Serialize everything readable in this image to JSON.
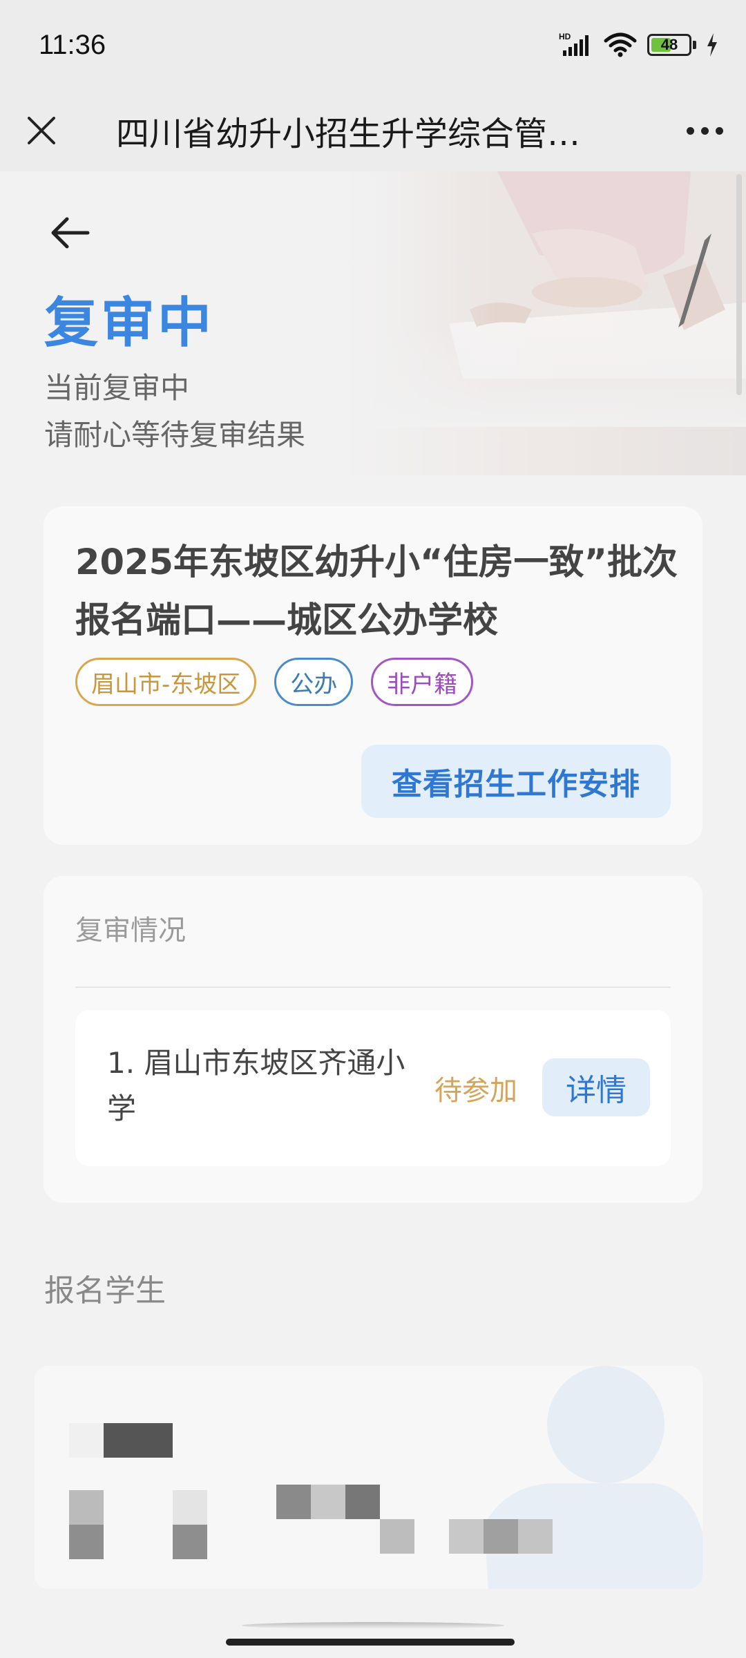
{
  "status_bar": {
    "time": "11:36",
    "network": "HD",
    "battery": "48"
  },
  "title_bar": {
    "title": "四川省幼升小招生升学综合管…"
  },
  "header": {
    "status_title": "复审中",
    "status_line1": "当前复审中",
    "status_line2": "请耐心等待复审结果"
  },
  "batch": {
    "title": "2025年东坡区幼升小“住房一致”批次报名端口——城区公办学校",
    "tags": [
      "眉山市-东坡区",
      "公办",
      "非户籍"
    ],
    "schedule_button": "查看招生工作安排"
  },
  "review": {
    "heading": "复审情况",
    "items": [
      {
        "name": "1. 眉山市东坡区齐通小学",
        "status": "待参加",
        "detail_label": "详情"
      }
    ]
  },
  "students": {
    "heading": "报名学生"
  },
  "colors": {
    "accent": "#3a86e0",
    "status_pending": "#d3a45a",
    "tag_region": "#c9963c",
    "tag_public": "#3a7ab8",
    "tag_huji": "#9a4cbc"
  }
}
